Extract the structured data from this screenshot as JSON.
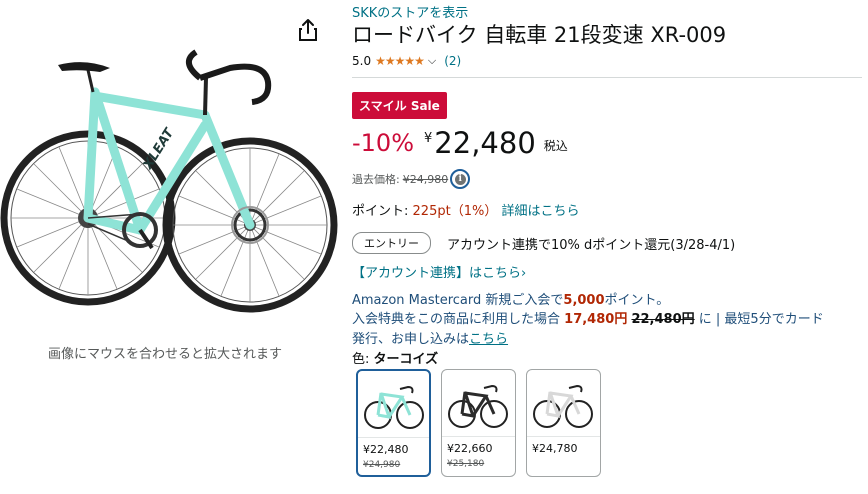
{
  "image_panel": {
    "hover_hint": "画像にマウスを合わせると拡大されます",
    "share_icon": "share-icon",
    "frame_color": "#8ee3d6",
    "frame_text": "XLEAT"
  },
  "product": {
    "store_link": "SKKのストアを表示",
    "title": "ロードバイク 自転車 21段変速 XR-009",
    "rating_value": "5.0",
    "stars": "★★★★★",
    "review_count": "(2)",
    "badge": "スマイル Sale"
  },
  "price": {
    "discount": "-10%",
    "yen_symbol": "¥",
    "amount": "22,480",
    "tax_label": "税込",
    "past_label": "過去価格:",
    "past_price": "¥24,980"
  },
  "points": {
    "label": "ポイント:",
    "value": "225pt（1%）",
    "details_link": "詳細はこちら"
  },
  "entry": {
    "button": "エントリー",
    "text": "アカウント連携で10% dポイント還元(3/28-4/1)",
    "account_link": "【アカウント連携】はこちら›"
  },
  "card_offer": {
    "line1_prefix": "Amazon Mastercard 新規ご入会で",
    "line1_points": "5,000",
    "line1_suffix": "ポイント。",
    "line2_prefix": "入会特典をこの商品に利用した場合",
    "line2_new_price": "17,480円",
    "line2_old_price": "22,480円",
    "line2_suffix": "に | 最短5分でカード",
    "line3_prefix": "発行、お申し込みは",
    "line3_link": "こちら"
  },
  "color": {
    "label": "色:",
    "selected": "ターコイズ"
  },
  "swatches": [
    {
      "price": "¥22,480",
      "old_price": "¥24,980",
      "frame": "#8ee3d6"
    },
    {
      "price": "¥22,660",
      "old_price": "¥25,180",
      "frame": "#2b2b2b"
    },
    {
      "price": "¥24,780",
      "old_price": "",
      "frame": "#f2f2f2"
    }
  ]
}
